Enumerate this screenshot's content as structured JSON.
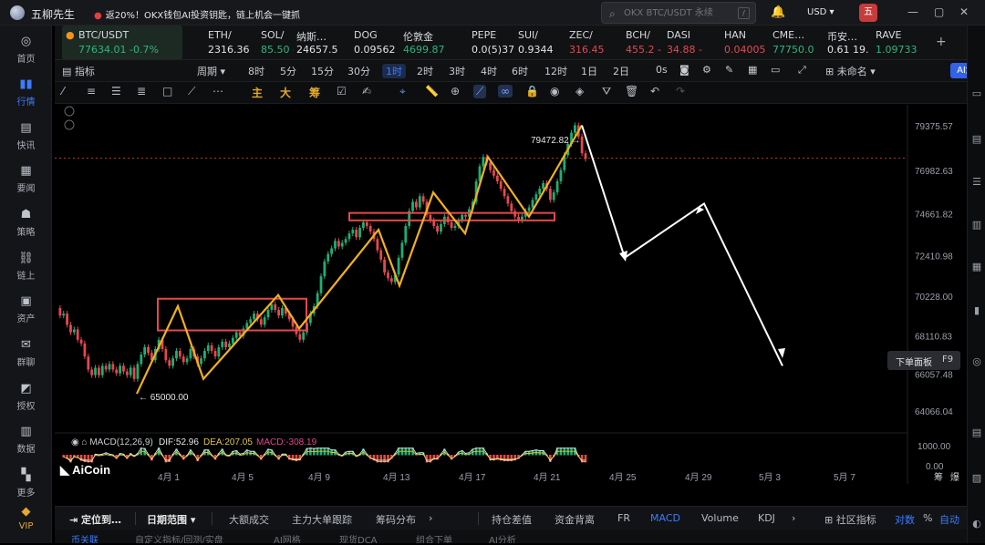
{
  "titlebar": {
    "app_name": "五柳先生",
    "promo": "返20%！OKX钱包AI投资钥匙，链上机会一键抓",
    "search_placeholder": "OKX BTC/USDT 永续",
    "currency": "USD",
    "window_controls": [
      "—",
      "▢",
      "✕"
    ]
  },
  "sidebar": {
    "items": [
      {
        "icon": "okx-icon",
        "label": "首页"
      },
      {
        "icon": "bar-chart-icon",
        "label": "行情",
        "active": true
      },
      {
        "icon": "newsflash-icon",
        "label": "快讯"
      },
      {
        "icon": "news-icon",
        "label": "要闻"
      },
      {
        "icon": "strategy-icon",
        "label": "策略"
      },
      {
        "icon": "onchain-icon",
        "label": "链上"
      },
      {
        "icon": "wallet-icon",
        "label": "资产"
      },
      {
        "icon": "chat-icon",
        "label": "群聊"
      },
      {
        "icon": "options-icon",
        "label": "授权"
      },
      {
        "icon": "data-icon",
        "label": "数据"
      },
      {
        "icon": "more-icon",
        "label": "更多"
      },
      {
        "icon": "vip-icon",
        "label": "VIP"
      }
    ]
  },
  "tickers": [
    {
      "name": "BTC/USDT",
      "price": "77634.01",
      "change": "-0.7%",
      "dir": "up",
      "selected": true
    },
    {
      "name": "ETH/",
      "price": "2316.36",
      "dir": "neu"
    },
    {
      "name": "SOL/",
      "price": "85.50 -",
      "dir": "up"
    },
    {
      "name": "纳斯…",
      "price": "24657.5",
      "dir": "neu"
    },
    {
      "name": "DOG",
      "price": "0.09562",
      "dir": "neu"
    },
    {
      "name": "伦敦金",
      "price": "4699.87",
      "dir": "up"
    },
    {
      "name": "PEPE",
      "price": "0.0(5)37",
      "dir": "neu"
    },
    {
      "name": "SUI/",
      "price": "0.9344",
      "dir": "neu"
    },
    {
      "name": "ZEC/",
      "price": "316.45",
      "dir": "dn"
    },
    {
      "name": "BCH/",
      "price": "455.2 -",
      "dir": "dn"
    },
    {
      "name": "DASI",
      "price": "34.88 -",
      "dir": "dn"
    },
    {
      "name": "HAN",
      "price": "0.04005",
      "dir": "dn"
    },
    {
      "name": "CME…",
      "price": "77750.0",
      "dir": "up"
    },
    {
      "name": "币安…",
      "price": "0.61 19.",
      "dir": "neu"
    },
    {
      "name": "RAVE",
      "price": "1.09733",
      "dir": "up"
    }
  ],
  "toolbar": {
    "indicator": "指标",
    "period": "周期",
    "intervals": [
      "8时",
      "5分",
      "15分",
      "30分",
      "1时",
      "2时",
      "3时",
      "4时",
      "6时",
      "12时",
      "1日",
      "2日"
    ],
    "active_interval": "1时",
    "timer": "0s",
    "status": "未命名",
    "ai_label": "AI解读"
  },
  "drawing_tools": {
    "labels": [
      "主",
      "大",
      "筹"
    ]
  },
  "chart_data": {
    "type": "line",
    "symbol": "BTC/USDT",
    "y_ticks": [
      "79375.57",
      "76982.63",
      "74661.82",
      "72410.98",
      "70228.00",
      "68110.83",
      "66057.48",
      "64066.04"
    ],
    "x_ticks": [
      "4月 1",
      "4月 5",
      "4月 9",
      "4月 13",
      "4月 17",
      "4月 21",
      "4月 25",
      "4月 29",
      "5月 3",
      "5月 7"
    ],
    "high_label": "79472.82",
    "low_label": "65000.00",
    "current_price_line": 77634.01,
    "ylim": [
      63000,
      80500
    ],
    "price_path": [
      [
        0,
        69600
      ],
      [
        1,
        69200
      ],
      [
        2,
        69300
      ],
      [
        3,
        68700
      ],
      [
        4,
        68300
      ],
      [
        5,
        68450
      ],
      [
        6,
        67900
      ],
      [
        7,
        67700
      ],
      [
        8,
        67000
      ],
      [
        9,
        66300
      ],
      [
        10,
        66000
      ],
      [
        11,
        66400
      ],
      [
        12,
        66000
      ],
      [
        13,
        66500
      ],
      [
        14,
        66300
      ],
      [
        15,
        66600
      ],
      [
        16,
        66300
      ],
      [
        17,
        66100
      ],
      [
        18,
        66500
      ],
      [
        19,
        66200
      ],
      [
        20,
        66000
      ],
      [
        21,
        66400
      ],
      [
        22,
        65800
      ],
      [
        23,
        66600
      ],
      [
        24,
        67100
      ],
      [
        25,
        67500
      ],
      [
        26,
        67200
      ],
      [
        27,
        66800
      ],
      [
        28,
        67400
      ],
      [
        29,
        67900
      ],
      [
        30,
        67400
      ],
      [
        31,
        66800
      ],
      [
        32,
        66500
      ],
      [
        33,
        66900
      ],
      [
        34,
        67300
      ],
      [
        35,
        67000
      ],
      [
        36,
        66700
      ],
      [
        37,
        66900
      ],
      [
        38,
        67400
      ],
      [
        39,
        67000
      ],
      [
        40,
        66600
      ],
      [
        41,
        66900
      ],
      [
        42,
        67300
      ],
      [
        43,
        67600
      ],
      [
        44,
        67300
      ],
      [
        45,
        67000
      ],
      [
        46,
        67500
      ],
      [
        47,
        67800
      ],
      [
        48,
        67500
      ],
      [
        49,
        67700
      ],
      [
        50,
        68000
      ],
      [
        51,
        68300
      ],
      [
        52,
        68100
      ],
      [
        53,
        68500
      ],
      [
        54,
        68800
      ],
      [
        55,
        69000
      ],
      [
        56,
        69300
      ],
      [
        57,
        69000
      ],
      [
        58,
        68700
      ],
      [
        59,
        69100
      ],
      [
        60,
        69500
      ],
      [
        61,
        69800
      ],
      [
        62,
        69500
      ],
      [
        63,
        69200
      ],
      [
        64,
        69600
      ],
      [
        65,
        69300
      ],
      [
        66,
        69000
      ],
      [
        67,
        68600
      ],
      [
        68,
        68200
      ],
      [
        69,
        67900
      ],
      [
        70,
        68300
      ],
      [
        71,
        68800
      ],
      [
        72,
        69300
      ],
      [
        73,
        69700
      ],
      [
        74,
        70400
      ],
      [
        75,
        71300
      ],
      [
        76,
        72100
      ],
      [
        77,
        72500
      ],
      [
        78,
        72800
      ],
      [
        79,
        73200
      ],
      [
        80,
        72900
      ],
      [
        81,
        73100
      ],
      [
        82,
        73300
      ],
      [
        83,
        73600
      ],
      [
        84,
        73800
      ],
      [
        85,
        73400
      ],
      [
        86,
        73900
      ],
      [
        87,
        74200
      ],
      [
        88,
        74000
      ],
      [
        89,
        73700
      ],
      [
        90,
        73300
      ],
      [
        91,
        72700
      ],
      [
        92,
        72200
      ],
      [
        93,
        71500
      ],
      [
        94,
        71200
      ],
      [
        95,
        71000
      ],
      [
        96,
        71400
      ],
      [
        97,
        72300
      ],
      [
        98,
        73100
      ],
      [
        99,
        74000
      ],
      [
        100,
        74800
      ],
      [
        101,
        75300
      ],
      [
        102,
        75000
      ],
      [
        103,
        75600
      ],
      [
        104,
        75300
      ],
      [
        105,
        74600
      ],
      [
        106,
        74300
      ],
      [
        107,
        74000
      ],
      [
        108,
        73700
      ],
      [
        109,
        74100
      ],
      [
        110,
        74500
      ],
      [
        111,
        74200
      ],
      [
        112,
        73900
      ],
      [
        113,
        74000
      ],
      [
        114,
        74300
      ],
      [
        115,
        74600
      ],
      [
        116,
        74500
      ],
      [
        117,
        74900
      ],
      [
        118,
        75300
      ],
      [
        119,
        76400
      ],
      [
        120,
        77200
      ],
      [
        121,
        77700
      ],
      [
        122,
        77400
      ],
      [
        123,
        77000
      ],
      [
        124,
        76700
      ],
      [
        125,
        76400
      ],
      [
        126,
        76000
      ],
      [
        127,
        75600
      ],
      [
        128,
        75200
      ],
      [
        129,
        74800
      ],
      [
        130,
        74500
      ],
      [
        131,
        74300
      ],
      [
        132,
        74500
      ],
      [
        133,
        74800
      ],
      [
        134,
        75000
      ],
      [
        135,
        75400
      ],
      [
        136,
        75700
      ],
      [
        137,
        76000
      ],
      [
        138,
        76300
      ],
      [
        139,
        76000
      ],
      [
        140,
        75400
      ],
      [
        141,
        75800
      ],
      [
        142,
        76400
      ],
      [
        143,
        77000
      ],
      [
        144,
        77800
      ],
      [
        145,
        78400
      ],
      [
        146,
        79000
      ],
      [
        147,
        79400
      ],
      [
        148,
        78800
      ],
      [
        149,
        77900
      ],
      [
        150,
        77600
      ]
    ],
    "gold_zigzag": [
      [
        65000,
        0
      ],
      [
        69700,
        0
      ],
      [
        65800,
        0
      ],
      [
        70300,
        0
      ],
      [
        68500,
        0
      ],
      [
        73800,
        0
      ],
      [
        70800,
        0
      ],
      [
        75800,
        0
      ],
      [
        73600,
        0
      ],
      [
        77700,
        0
      ],
      [
        74500,
        0
      ],
      [
        79400,
        0
      ]
    ],
    "white_projection": [
      [
        79400,
        0
      ],
      [
        72300,
        0
      ],
      [
        75200,
        0
      ],
      [
        66500,
        0
      ]
    ],
    "boxes": [
      {
        "low": 68400,
        "high": 70100
      },
      {
        "low": 74300,
        "high": 74700
      }
    ],
    "macd": {
      "label": "MACD(12,26,9)",
      "dif": "DIF:52.96",
      "dea": "DEA:207.05",
      "macd": "MACD:-308.19",
      "y_ticks": [
        "1000.00",
        "0.00"
      ]
    }
  },
  "watermark": "AiCoin",
  "order_panel": {
    "label": "下单面板",
    "hotkey": "F9"
  },
  "bottom_tabs": [
    "定位到…",
    "日期范围",
    "大额成交",
    "主力大单跟踪",
    "筹码分布",
    "持仓差值",
    "资金背离",
    "FR",
    "MACD",
    "Volume",
    "KDJ",
    "社区指标",
    "对数",
    "%",
    "自动"
  ],
  "bottom_right": [
    "筹",
    "爆"
  ],
  "footer_tabs": [
    "币关联",
    "自定义指标/回测/实盘",
    "AI网格",
    "现货DCA",
    "组合下单",
    "AI分析"
  ]
}
